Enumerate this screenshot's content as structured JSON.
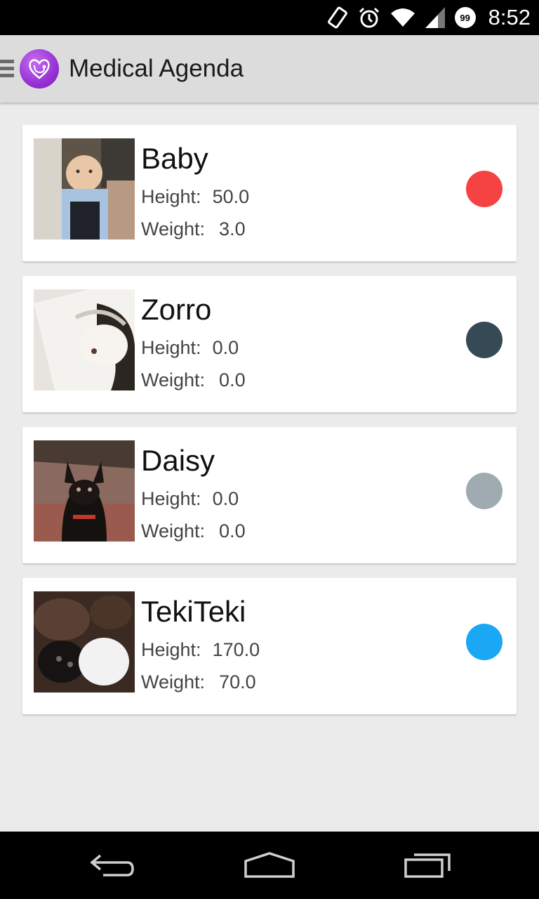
{
  "status_bar": {
    "time": "8:52",
    "battery_level": "99",
    "icons": [
      "rotate-icon",
      "alarm-icon",
      "wifi-icon",
      "signal-icon",
      "battery-icon"
    ]
  },
  "app_bar": {
    "title": "Medical Agenda",
    "logo_icon": "heart-stethoscope-icon"
  },
  "pets": [
    {
      "name": "Baby",
      "height_label": "Height:",
      "height": "50.0",
      "weight_label": "Weight:",
      "weight": "3.0",
      "color": "#f54242"
    },
    {
      "name": "Zorro",
      "height_label": "Height:",
      "height": "0.0",
      "weight_label": "Weight:",
      "weight": "0.0",
      "color": "#364a56"
    },
    {
      "name": "Daisy",
      "height_label": "Height:",
      "height": "0.0",
      "weight_label": "Weight:",
      "weight": "0.0",
      "color": "#9faab1"
    },
    {
      "name": "TekiTeki",
      "height_label": "Height:",
      "height": "170.0",
      "weight_label": "Weight:",
      "weight": "70.0",
      "color": "#1aa8f5"
    }
  ],
  "nav_bar": {
    "icons": [
      "back-icon",
      "home-icon",
      "recent-apps-icon"
    ]
  }
}
